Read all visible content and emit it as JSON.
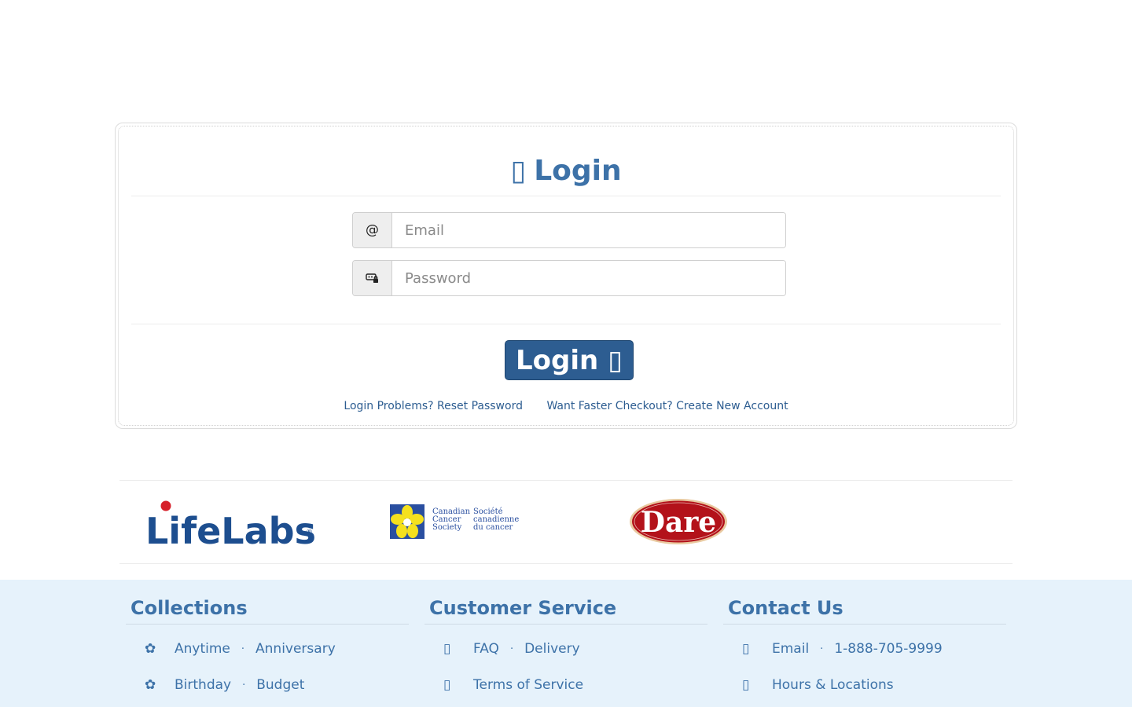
{
  "login": {
    "title_icon": "▯",
    "title": "Login",
    "email_icon": "@",
    "email_placeholder": "Email",
    "email_value": "",
    "password_icon": "⚿",
    "password_placeholder": "Password",
    "password_value": "",
    "button_label": "Login",
    "button_icon": "▯",
    "reset_link": "Login Problems? Reset Password",
    "create_link": "Want Faster Checkout? Create New Account"
  },
  "sponsors": [
    {
      "name": "LifeLabs",
      "logo": "lifelabs-logo"
    },
    {
      "name_en": [
        "Canadian",
        "Cancer",
        "Society"
      ],
      "name_fr": [
        "Société",
        "canadienne",
        "du cancer"
      ],
      "logo": "canadian-cancer-society-logo"
    },
    {
      "name": "Dare",
      "logo": "dare-logo"
    }
  ],
  "footer": {
    "collections": {
      "heading": "Collections",
      "icon": "✿",
      "row1": [
        "Anytime",
        "Anniversary"
      ],
      "row2": [
        "Birthday",
        "Budget"
      ]
    },
    "customer_service": {
      "heading": "Customer Service",
      "icon": "▯",
      "row1": [
        "FAQ",
        "Delivery"
      ],
      "row2": [
        "Terms of Service"
      ]
    },
    "contact": {
      "heading": "Contact Us",
      "icon": "▯",
      "row1": [
        "Email",
        "1-888-705-9999"
      ],
      "row2": [
        "Hours & Locations"
      ]
    },
    "separator": "·"
  },
  "colors": {
    "accent": "#3d72a8",
    "button": "#2d5d91",
    "footer_bg": "#e6f2fb",
    "lifelabs_blue": "#1d4e8f",
    "lifelabs_red": "#d6202a",
    "dare_red": "#b3121a"
  }
}
